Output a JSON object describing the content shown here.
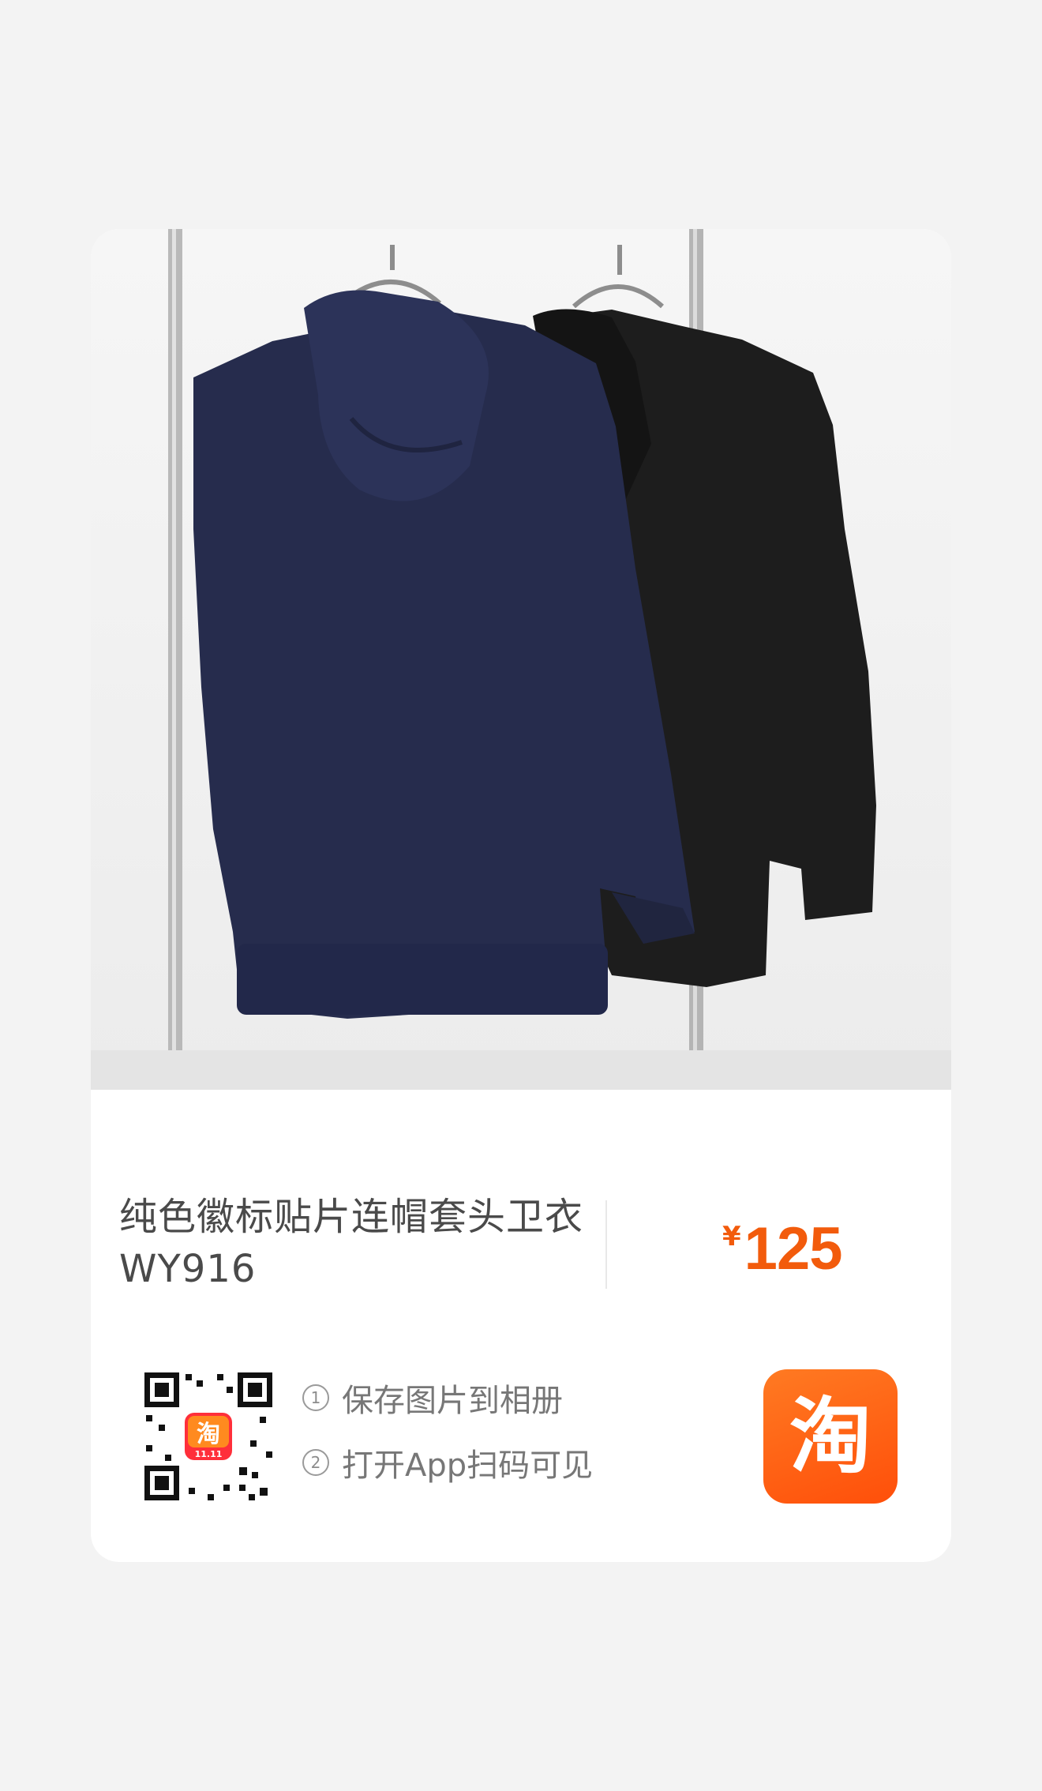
{
  "product": {
    "title_line1": "纯色徽标贴片连帽套头卫衣",
    "title_line2": "WY916",
    "currency_symbol": "¥",
    "price": "125"
  },
  "share": {
    "qr_badge_text": "淘",
    "qr_badge_sub": "11.11",
    "steps": [
      {
        "num": "1",
        "text": "保存图片到相册"
      },
      {
        "num": "2",
        "text": "打开App扫码可见"
      }
    ],
    "app_logo_char": "淘"
  },
  "colors": {
    "price": "#f25b0c",
    "logo_bg": "#ff5a10",
    "page_bg": "#f3f3f3",
    "card_bg": "#ffffff"
  },
  "icons": {
    "qr": "qr-code-icon",
    "app": "taobao-logo-icon"
  }
}
